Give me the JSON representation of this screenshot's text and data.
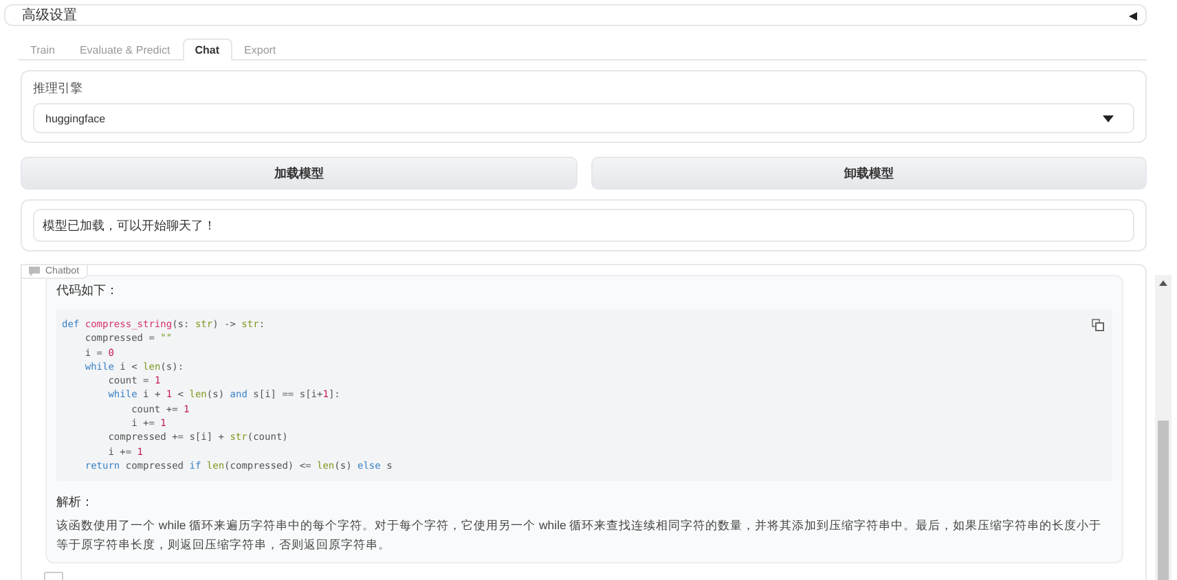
{
  "accordion": {
    "title": "高级设置",
    "expanded": false,
    "toggle": "◀"
  },
  "tabs": [
    {
      "label": "Train",
      "selected": false
    },
    {
      "label": "Evaluate & Predict",
      "selected": false
    },
    {
      "label": "Chat",
      "selected": true
    },
    {
      "label": "Export",
      "selected": false
    }
  ],
  "engine": {
    "label": "推理引擎",
    "value": "huggingface"
  },
  "buttons": [
    "加载模型",
    "卸载模型"
  ],
  "status": {
    "value": "模型已加载，可以开始聊天了！"
  },
  "chatbot": {
    "label": "Chatbot",
    "message": {
      "intro": "代码如下：",
      "code": [
        [
          {
            "kind": "keyword",
            "text": "def "
          },
          {
            "kind": "function",
            "text": "compress_string"
          },
          {
            "kind": "plain",
            "text": "(s: "
          },
          {
            "kind": "builtin",
            "text": "str"
          },
          {
            "kind": "plain",
            "text": ") -> "
          },
          {
            "kind": "builtin",
            "text": "str"
          },
          {
            "kind": "plain",
            "text": ":"
          }
        ],
        [
          {
            "kind": "plain",
            "text": "    compressed = "
          },
          {
            "kind": "string",
            "text": "\"\""
          }
        ],
        [
          {
            "kind": "plain",
            "text": "    i = "
          },
          {
            "kind": "number",
            "text": "0"
          }
        ],
        [
          {
            "kind": "keyword",
            "text": "    while"
          },
          {
            "kind": "plain",
            "text": " i < "
          },
          {
            "kind": "builtin",
            "text": "len"
          },
          {
            "kind": "plain",
            "text": "(s):"
          }
        ],
        [
          {
            "kind": "plain",
            "text": "        count = "
          },
          {
            "kind": "number",
            "text": "1"
          }
        ],
        [
          {
            "kind": "keyword",
            "text": "        while"
          },
          {
            "kind": "plain",
            "text": " i + "
          },
          {
            "kind": "number",
            "text": "1"
          },
          {
            "kind": "plain",
            "text": " < "
          },
          {
            "kind": "builtin",
            "text": "len"
          },
          {
            "kind": "plain",
            "text": "(s) "
          },
          {
            "kind": "keyword",
            "text": "and"
          },
          {
            "kind": "plain",
            "text": " s[i] == s[i+"
          },
          {
            "kind": "number",
            "text": "1"
          },
          {
            "kind": "plain",
            "text": "]:"
          }
        ],
        [
          {
            "kind": "plain",
            "text": "            count += "
          },
          {
            "kind": "number",
            "text": "1"
          }
        ],
        [
          {
            "kind": "plain",
            "text": "            i += "
          },
          {
            "kind": "number",
            "text": "1"
          }
        ],
        [
          {
            "kind": "plain",
            "text": "        compressed += s[i] + "
          },
          {
            "kind": "builtin",
            "text": "str"
          },
          {
            "kind": "plain",
            "text": "(count)"
          }
        ],
        [
          {
            "kind": "plain",
            "text": "        i += "
          },
          {
            "kind": "number",
            "text": "1"
          }
        ],
        [
          {
            "kind": "keyword",
            "text": "    return"
          },
          {
            "kind": "plain",
            "text": " compressed "
          },
          {
            "kind": "keyword",
            "text": "if "
          },
          {
            "kind": "builtin",
            "text": "len"
          },
          {
            "kind": "plain",
            "text": "(compressed) <= "
          },
          {
            "kind": "builtin",
            "text": "len"
          },
          {
            "kind": "plain",
            "text": "(s) "
          },
          {
            "kind": "keyword",
            "text": "else"
          },
          {
            "kind": "plain",
            "text": " s"
          }
        ]
      ],
      "analysis_title": "解析：",
      "analysis": "该函数使用了一个 while 循环来遍历字符串中的每个字符。对于每个字符，它使用另一个 while 循环来查找连续相同字符的数量，并将其添加到压缩字符串中。最后，如果压缩字符串的长度小于等于原字符串长度，则返回压缩字符串，否则返回原字符串。"
    }
  }
}
